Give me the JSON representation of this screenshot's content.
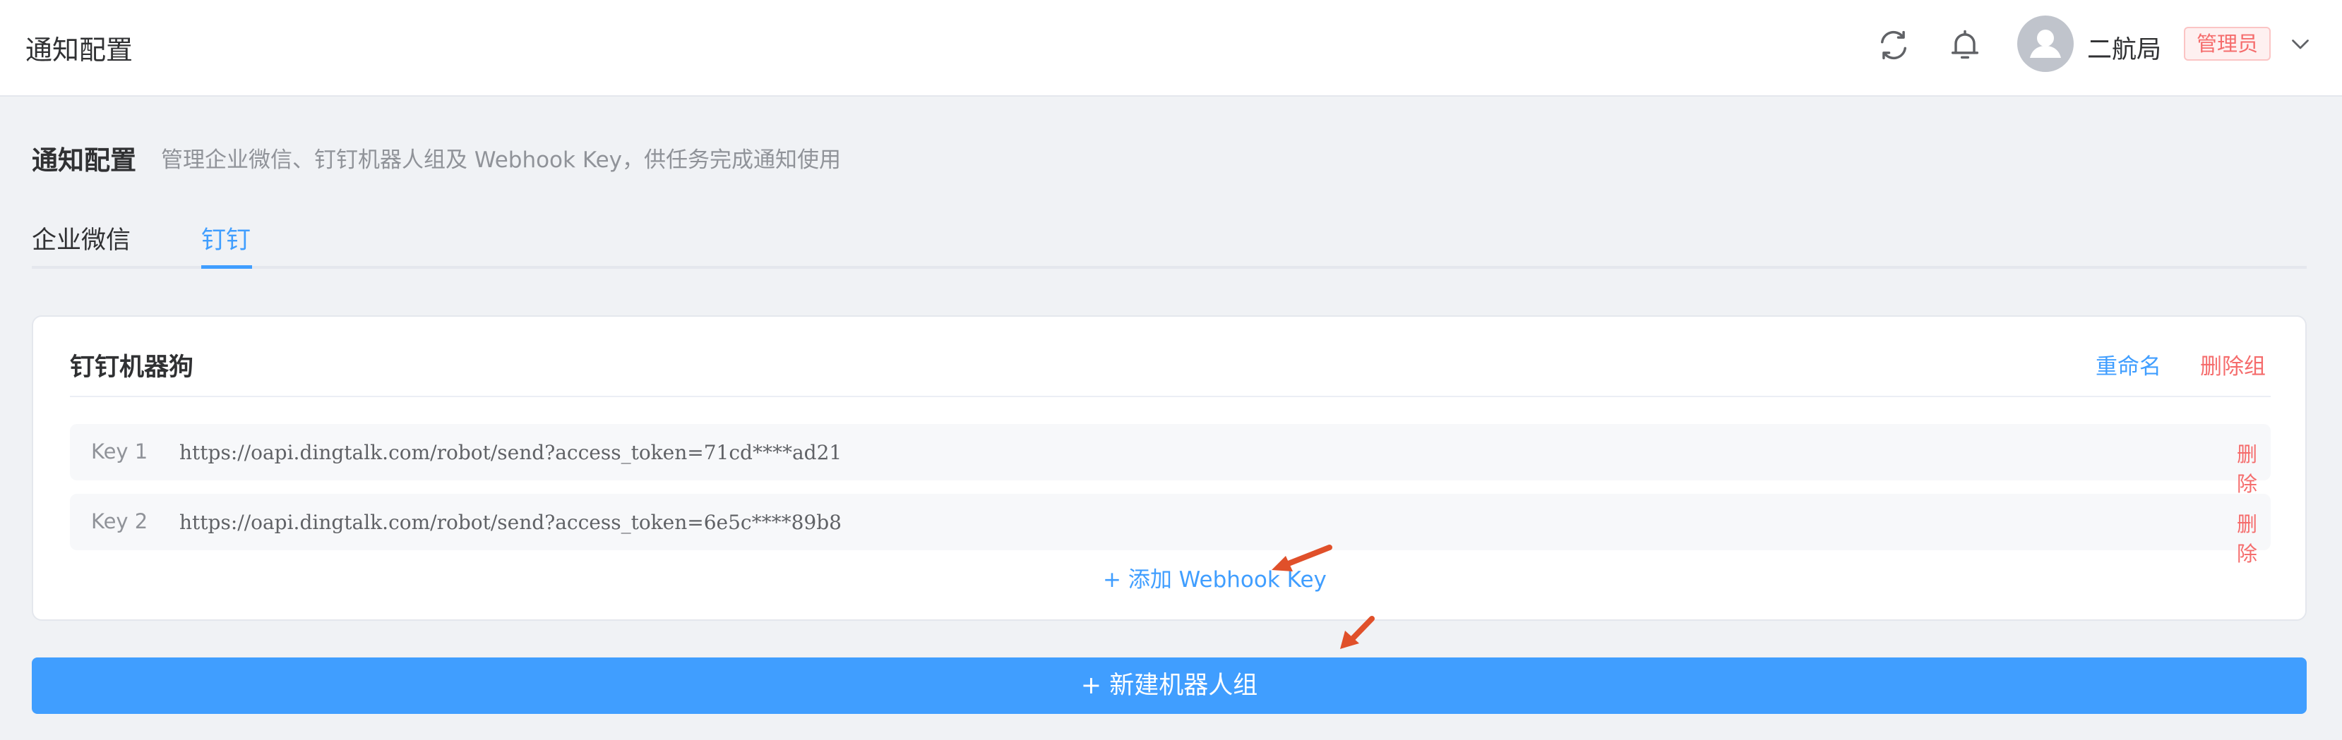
{
  "header": {
    "app_title": "通知配置",
    "icons": [
      "refresh-icon",
      "bell-icon",
      "user-icon",
      "chevron-down-icon"
    ],
    "user": {
      "name": "二航局",
      "role": "管理员"
    }
  },
  "page": {
    "title": "通知配置",
    "description": "管理企业微信、钉钉机器人组及 Webhook Key，供任务完成通知使用"
  },
  "tabs": [
    {
      "label": "企业微信",
      "active": false
    },
    {
      "label": "钉钉",
      "active": true
    }
  ],
  "group": {
    "name": "钉钉机器狗",
    "rename_label": "重命名",
    "delete_group_label": "删除组",
    "keys": [
      {
        "label": "Key 1",
        "url": "https://oapi.dingtalk.com/robot/send?access_token=71cd****ad21",
        "delete_label": "删除"
      },
      {
        "label": "Key 2",
        "url": "https://oapi.dingtalk.com/robot/send?access_token=6e5c****89b8",
        "delete_label": "删除"
      }
    ],
    "add_key_label": "+ 添加 Webhook Key"
  },
  "new_group_label": "+ 新建机器人组",
  "colors": {
    "primary": "#409eff",
    "danger": "#f56c6c",
    "annotation_arrow": "#e0502a",
    "background": "#f0f2f5"
  }
}
